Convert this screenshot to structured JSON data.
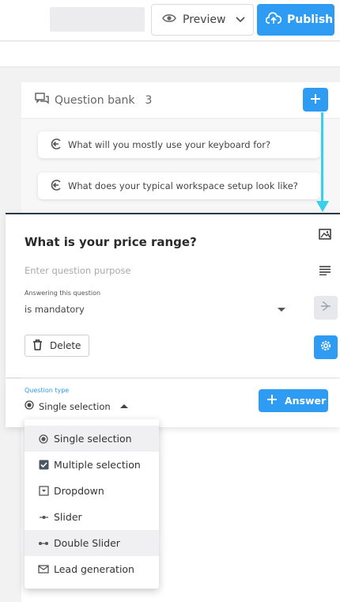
{
  "topbar": {
    "preview_label": "Preview",
    "publish_label": "Publish",
    "accent_color": "#2f9cf4"
  },
  "question_bank": {
    "title": "Question bank",
    "count": "3",
    "items": [
      {
        "text": "What will you mostly use your keyboard for?"
      },
      {
        "text": "What does your typical workspace setup look like?"
      }
    ]
  },
  "question_card": {
    "title": "What is your price range?",
    "purpose_placeholder": "Enter question purpose",
    "answering_label": "Answering this question",
    "answering_value": "is mandatory",
    "delete_label": "Delete",
    "question_type_label": "Question type",
    "question_type_value": "Single selection",
    "answer_button_label": "Answer"
  },
  "question_type_menu": {
    "options": [
      {
        "label": "Single selection",
        "icon": "radio-icon"
      },
      {
        "label": "Multiple selection",
        "icon": "checkbox-icon"
      },
      {
        "label": "Dropdown",
        "icon": "dropdown-icon"
      },
      {
        "label": "Slider",
        "icon": "slider-icon"
      },
      {
        "label": "Double Slider",
        "icon": "double-slider-icon"
      },
      {
        "label": "Lead generation",
        "icon": "mail-icon"
      }
    ]
  }
}
